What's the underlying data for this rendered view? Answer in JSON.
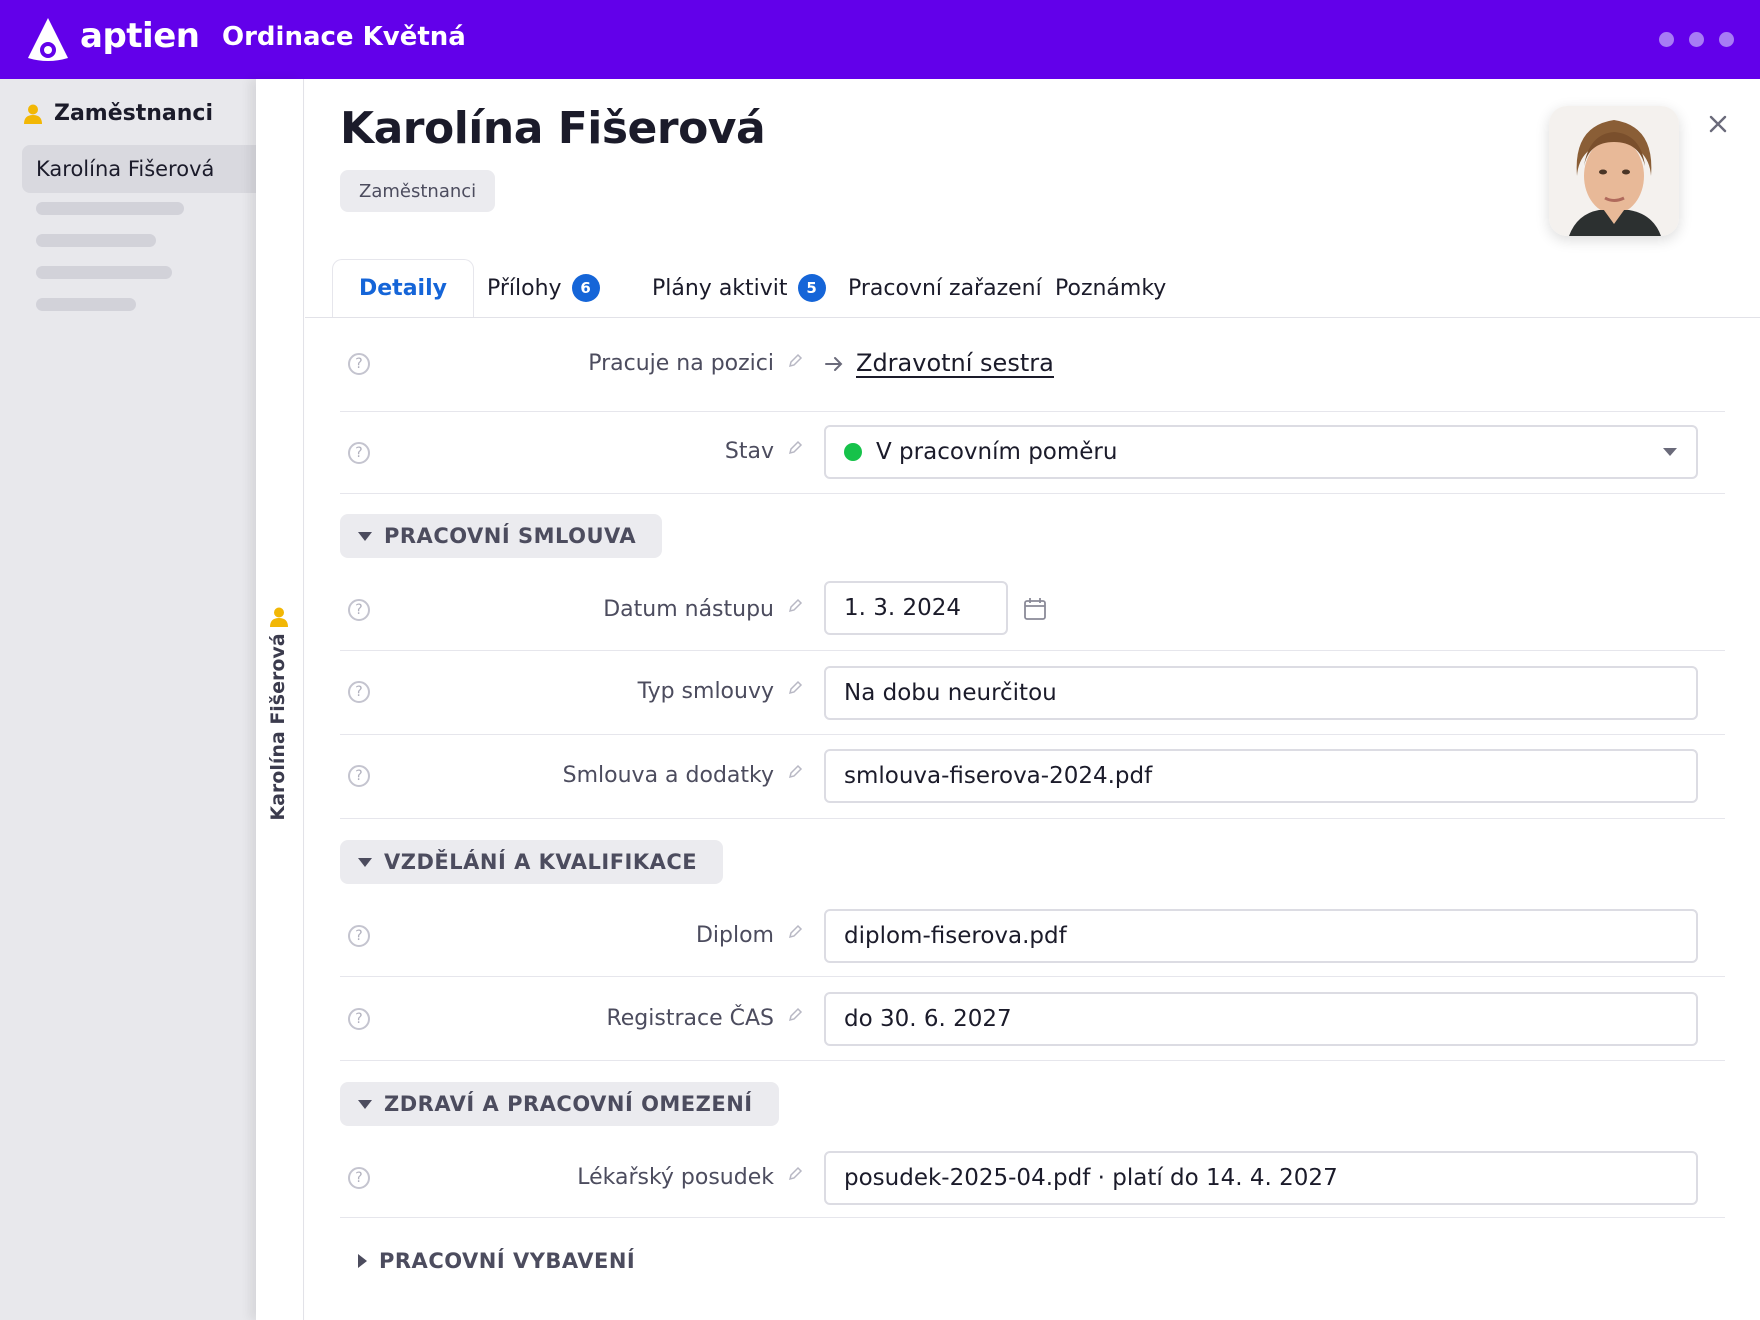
{
  "app": {
    "brand": "aptien",
    "organization": "Ordinace Květná"
  },
  "sidebar": {
    "section_label": "Zaměstnanci",
    "active_item": "Karolína Fišerová"
  },
  "side_strip": {
    "label": "Karolína Fišerová"
  },
  "record": {
    "title": "Karolína Fišerová",
    "tag": "Zaměstnanci"
  },
  "tabs": [
    {
      "label": "Detaily",
      "active": true
    },
    {
      "label": "Přílohy",
      "badge": "6"
    },
    {
      "label": "Plány aktivit",
      "badge": "5"
    },
    {
      "label": "Pracovní zařazení"
    },
    {
      "label": "Poznámky"
    }
  ],
  "fields": {
    "position": {
      "label": "Pracuje na pozici",
      "value": "Zdravotní sestra"
    },
    "status": {
      "label": "Stav",
      "value": "V pracovním poměru",
      "status_color": "#16c24a"
    },
    "start_date": {
      "label": "Datum nástupu",
      "value": "1. 3. 2024"
    },
    "contract_type": {
      "label": "Typ smlouvy",
      "value": "Na dobu neurčitou"
    },
    "contract_files": {
      "label": "Smlouva a dodatky",
      "value": "smlouva-fiserova-2024.pdf"
    },
    "diploma": {
      "label": "Diplom",
      "value": "diplom-fiserova.pdf"
    },
    "registration": {
      "label": "Registrace ČAS",
      "value": "do 30. 6. 2027"
    },
    "medical": {
      "label": "Lékařský posudek",
      "value": "posudek-2025-04.pdf · platí do 14. 4. 2027"
    }
  },
  "sections": {
    "contract": "PRACOVNÍ SMLOUVA",
    "education": "VZDĚLÁNÍ A KVALIFIKACE",
    "health": "ZDRAVÍ A PRACOVNÍ OMEZENÍ",
    "equipment": "PRACOVNÍ VYBAVENÍ"
  },
  "help_symbol": "?",
  "colors": {
    "brand": "#6200ea",
    "accent": "#1565d8",
    "person_icon": "#f2b705"
  }
}
